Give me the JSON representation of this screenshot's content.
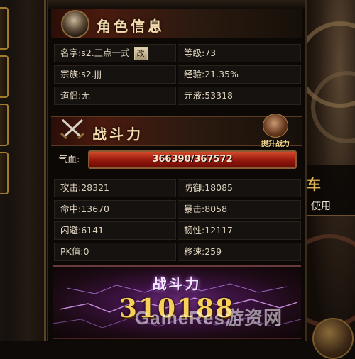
{
  "role_panel": {
    "title": "角色信息",
    "rows": [
      {
        "left_label": "名字",
        "left_value": ":s2.三点一式",
        "right_label": "等级",
        "right_value": ":73"
      },
      {
        "left_label": "宗族",
        "left_value": ":s2.jjj",
        "right_label": "经验",
        "right_value": ":21.35%"
      },
      {
        "left_label": "道侣",
        "left_value": ":无",
        "right_label": "元液",
        "right_value": ":53318"
      }
    ],
    "rename_button": "改"
  },
  "combat_panel": {
    "title": "战斗力",
    "upgrade_label": "提升战力",
    "hp_label": "气血:",
    "hp_text": "366390/367572",
    "hp_fraction": 0.9968,
    "rows": [
      {
        "left_label": "攻击",
        "left_value": ":28321",
        "right_label": "防御",
        "right_value": ":18085"
      },
      {
        "left_label": "命中",
        "left_value": ":13670",
        "right_label": "暴击",
        "right_value": ":8058"
      },
      {
        "left_label": "闪避",
        "left_value": ":6141",
        "right_label": "韧性",
        "right_value": ":12117"
      },
      {
        "left_label": "PK值",
        "left_value": ":0",
        "right_label": "移速",
        "right_value": ":259"
      }
    ]
  },
  "combat_power": {
    "title": "战斗力",
    "value": "310188"
  },
  "side_tooltip": {
    "title": "车",
    "action": "使用"
  },
  "watermark": "GameRes游资网",
  "colors": {
    "gold": "#f7cf5a",
    "hp_red": "#b2231a",
    "panel_bg": "#0b0806"
  },
  "icons": [
    "character-avatar-icon",
    "crossed-swords-icon",
    "upgrade-power-icon"
  ]
}
